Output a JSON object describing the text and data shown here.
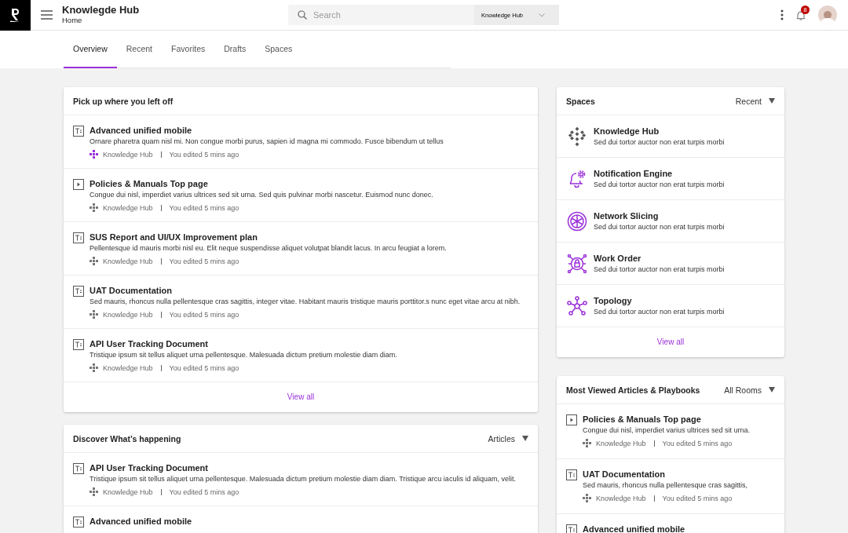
{
  "header": {
    "title": "Knowlegde Hub",
    "subtitle": "Home",
    "search": {
      "placeholder": "Search",
      "scope": "Knowledge Hub"
    },
    "notifications": "8"
  },
  "tabs": [
    {
      "label": "Overview",
      "selected": true
    },
    {
      "label": "Recent",
      "selected": false
    },
    {
      "label": "Favorites",
      "selected": false
    },
    {
      "label": "Drafts",
      "selected": false
    },
    {
      "label": "Spaces",
      "selected": false
    }
  ],
  "pickup": {
    "title": "Pick up where you left off",
    "items": [
      {
        "kind": "text",
        "title": "Advanced unified mobile",
        "description": "Ornare pharetra quam nisl mi. Non congue morbi purus, sapien id magna mi commodo. Fusce bibendum ut tellus",
        "space": "Knowledge Hub",
        "color": "#9b30d9",
        "edited": "You edited 5 mins ago"
      },
      {
        "kind": "video",
        "title": "Policies & Manuals Top page",
        "description": "Congue dui nisl, imperdiet varius ultrices sed sit urna. Sed quis pulvinar morbi nascetur. Euismod nunc donec.",
        "space": "Knowledge Hub",
        "color": "#777777",
        "edited": "You edited 5 mins ago"
      },
      {
        "kind": "text",
        "title": "SUS Report and UI/UX Improvement plan",
        "description": "Pellentesque id mauris morbi nisl eu. Elit neque suspendisse aliquet volutpat blandit lacus. In arcu feugiat a lorem.",
        "space": "Knowledge Hub",
        "color": "#777777",
        "edited": "You edited 5 mins ago"
      },
      {
        "kind": "text",
        "title": "UAT Documentation",
        "description": "Sed mauris, rhoncus nulla pellentesque cras sagittis, integer vitae. Habitant mauris tristique mauris porttitor.s nunc eget vitae arcu at nibh.",
        "space": "Knowledge Hub",
        "color": "#777777",
        "edited": "You edited 5 mins ago"
      },
      {
        "kind": "text",
        "title": "API User Tracking Document",
        "description": "Tristique ipsum sit tellus aliquet urna pellentesque. Malesuada dictum pretium molestie diam diam.",
        "space": "Knowledge Hub",
        "color": "#777777",
        "edited": "You edited 5 mins ago"
      }
    ],
    "view_all": "View all"
  },
  "discover": {
    "title": "Discover What’s happening",
    "filter": "Articles",
    "items": [
      {
        "kind": "text",
        "title": "API User Tracking Document",
        "description": "Tristique ipsum sit tellus aliquet urna pellentesque. Malesuada dictum pretium molestie diam diam. Tristique arcu iaculis id aliquam, velit.",
        "space": "Knowledge Hub",
        "color": "#777777",
        "edited": "You edited 5 mins ago"
      },
      {
        "kind": "text",
        "title": "Advanced unified mobile"
      }
    ]
  },
  "spaces": {
    "title": "Spaces",
    "filter": "Recent",
    "items": [
      {
        "kind": "hub",
        "name": "Knowledge Hub",
        "description": "Sed dui tortor auctor non erat turpis morbi"
      },
      {
        "kind": "bell",
        "name": "Notification Engine",
        "description": "Sed dui tortor auctor non erat turpis morbi"
      },
      {
        "kind": "slicing",
        "name": "Network Slicing",
        "description": "Sed dui tortor auctor non erat turpis morbi"
      },
      {
        "kind": "lock",
        "name": "Work Order",
        "description": "Sed dui tortor auctor non erat turpis morbi"
      },
      {
        "kind": "topology",
        "name": "Topology",
        "description": "Sed dui tortor auctor non erat turpis morbi"
      }
    ],
    "view_all": "View all"
  },
  "most_viewed": {
    "title": "Most Viewed Articles & Playbooks",
    "filter": "All Rooms",
    "items": [
      {
        "kind": "video",
        "title": "Policies & Manuals Top page",
        "description": "Congue dui nisl, imperdiet varius ultrices sed sit urna.",
        "space": "Knowledge Hub",
        "color": "#777777",
        "edited": "You edited 5 mins ago"
      },
      {
        "kind": "text",
        "title": "UAT Documentation",
        "description": "Sed mauris, rhoncus nulla pellentesque cras sagittis,",
        "space": "Knowledge Hub",
        "color": "#777777",
        "edited": "You edited 5 mins ago"
      },
      {
        "kind": "text",
        "title": "Advanced unified mobile"
      }
    ]
  }
}
